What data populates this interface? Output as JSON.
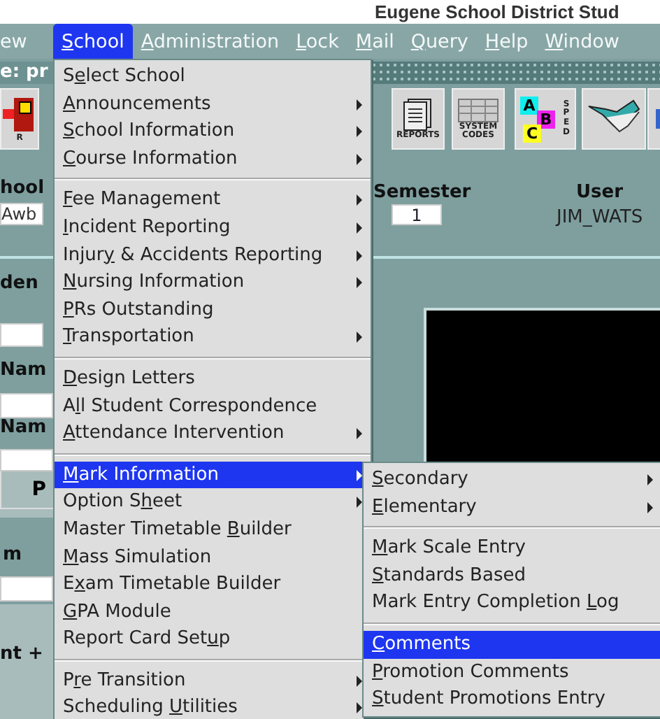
{
  "window": {
    "title": "Eugene School District Stud"
  },
  "menu_bar": [
    {
      "post": "ew",
      "selected": false
    },
    {
      "key": "S",
      "post": "chool",
      "selected": true
    },
    {
      "key": "A",
      "post": "dministration",
      "selected": false
    },
    {
      "key": "L",
      "post": "ock",
      "selected": false
    },
    {
      "key": "M",
      "post": "ail",
      "selected": false
    },
    {
      "key": "Q",
      "post": "uery",
      "selected": false
    },
    {
      "key": "H",
      "post": "elp",
      "selected": false
    },
    {
      "key": "W",
      "post": "indow",
      "selected": false
    }
  ],
  "status_strip": {
    "text": "e: pr"
  },
  "toolbar": [
    {
      "kind": "switch",
      "label": "R"
    },
    {
      "kind": "reports",
      "label": "REPORTS"
    },
    {
      "kind": "codes",
      "label": "SYSTEM CODES"
    },
    {
      "kind": "blocks",
      "letters": [
        "A",
        "B",
        "C"
      ],
      "label": "SPED"
    },
    {
      "kind": "handshake"
    },
    {
      "kind": "partial"
    }
  ],
  "form": {
    "left_labels": [
      "hool",
      "den",
      "Nam",
      "Nam",
      "m",
      "nt +"
    ],
    "school_field": "Awb",
    "button": "P",
    "semester_label": "Semester",
    "semester_value": "1",
    "user_label": "User",
    "user_value": "JIM_WATS"
  },
  "school_menu": [
    {
      "kind": "item",
      "pre": "S",
      "key": "e",
      "post": "lect School",
      "submenu": false,
      "selected": false
    },
    {
      "kind": "item",
      "key": "A",
      "post": "nnouncements",
      "submenu": true,
      "selected": false
    },
    {
      "kind": "item",
      "key": "S",
      "post": "chool Information",
      "submenu": true,
      "selected": false
    },
    {
      "kind": "item",
      "key": "C",
      "post": "ourse Information",
      "submenu": true,
      "selected": false
    },
    {
      "kind": "separator"
    },
    {
      "kind": "item",
      "key": "F",
      "post": "ee Management",
      "submenu": true,
      "selected": false
    },
    {
      "kind": "item",
      "key": "I",
      "post": "ncident Reporting",
      "submenu": true,
      "selected": false
    },
    {
      "kind": "item",
      "pre": "Injur",
      "key": "y",
      "post": " & Accidents Reporting",
      "submenu": true,
      "selected": false
    },
    {
      "kind": "item",
      "key": "N",
      "post": "ursing Information",
      "submenu": true,
      "selected": false
    },
    {
      "kind": "item",
      "key": "P",
      "post": "Rs Outstanding",
      "submenu": false,
      "selected": false
    },
    {
      "kind": "item",
      "key": "T",
      "post": "ransportation",
      "submenu": true,
      "selected": false
    },
    {
      "kind": "separator"
    },
    {
      "kind": "item",
      "key": "D",
      "post": "esign Letters",
      "submenu": false,
      "selected": false
    },
    {
      "kind": "item",
      "pre": "A",
      "key": "l",
      "post": "l Student Correspondence",
      "submenu": false,
      "selected": false
    },
    {
      "kind": "item",
      "key": "A",
      "post": "ttendance Intervention",
      "submenu": true,
      "selected": false
    },
    {
      "kind": "separator"
    },
    {
      "kind": "item",
      "key": "M",
      "post": "ark Information",
      "submenu": true,
      "selected": true
    },
    {
      "kind": "item",
      "pre": "Option S",
      "key": "h",
      "post": "eet",
      "submenu": true,
      "selected": false
    },
    {
      "kind": "item",
      "pre": "Master Timetable ",
      "key": "B",
      "post": "uilder",
      "submenu": false,
      "selected": false
    },
    {
      "kind": "item",
      "key": "M",
      "post": "ass Simulation",
      "submenu": false,
      "selected": false
    },
    {
      "kind": "item",
      "pre": "E",
      "key": "x",
      "post": "am Timetable Builder",
      "submenu": false,
      "selected": false
    },
    {
      "kind": "item",
      "key": "G",
      "post": "PA Module",
      "submenu": false,
      "selected": false
    },
    {
      "kind": "item",
      "pre": "Report Card Set",
      "key": "u",
      "post": "p",
      "submenu": false,
      "selected": false
    },
    {
      "kind": "separator"
    },
    {
      "kind": "item",
      "pre": "P",
      "key": "r",
      "post": "e Transition",
      "submenu": true,
      "selected": false
    },
    {
      "kind": "item",
      "pre": "Scheduling ",
      "key": "U",
      "post": "tilities",
      "submenu": true,
      "selected": false
    }
  ],
  "mark_menu": [
    {
      "kind": "item",
      "key": "S",
      "post": "econdary",
      "submenu": true,
      "selected": false
    },
    {
      "kind": "item",
      "key": "E",
      "post": "lementary",
      "submenu": true,
      "selected": false
    },
    {
      "kind": "separator"
    },
    {
      "kind": "item",
      "key": "M",
      "post": "ark Scale Entry",
      "submenu": false,
      "selected": false
    },
    {
      "kind": "item",
      "key": "S",
      "post": "tandards Based",
      "submenu": false,
      "selected": false
    },
    {
      "kind": "item",
      "pre": "Mark Entry Completion ",
      "key": "L",
      "post": "og",
      "submenu": false,
      "selected": false
    },
    {
      "kind": "separator"
    },
    {
      "kind": "item",
      "key": "C",
      "post": "omments",
      "submenu": false,
      "selected": true
    },
    {
      "kind": "item",
      "key": "P",
      "post": "romotion Comments",
      "submenu": false,
      "selected": false
    },
    {
      "kind": "item",
      "key": "S",
      "post": "tudent Promotions Entry",
      "submenu": false,
      "selected": false
    }
  ]
}
